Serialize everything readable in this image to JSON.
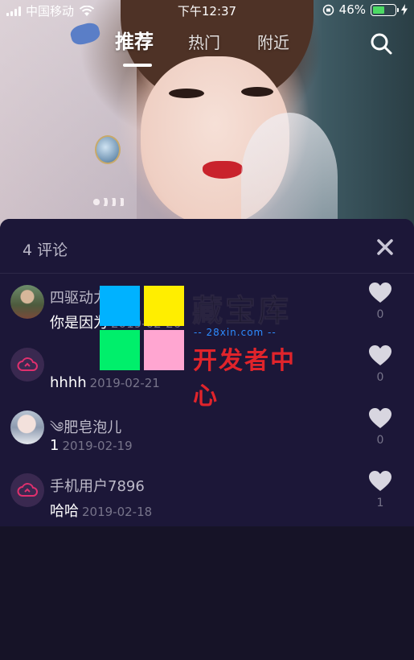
{
  "status_bar": {
    "carrier": "中国移动",
    "time": "下午12:37",
    "battery_percent": "46%",
    "battery_level": 0.46,
    "battery_color": "#4cd964"
  },
  "top_nav": {
    "tabs": [
      {
        "label": "推荐",
        "active": true
      },
      {
        "label": "热门",
        "active": false
      },
      {
        "label": "附近",
        "active": false
      }
    ],
    "search_icon": "search-icon"
  },
  "comments_panel": {
    "title": "4 评论",
    "close_icon": "close-icon",
    "items": [
      {
        "username": "四驱动力",
        "text": "你是因为",
        "date": "2019-02-26",
        "likes": "0",
        "avatar": "user-photo"
      },
      {
        "username": "",
        "text": "hhhh",
        "date": "2019-02-21",
        "likes": "0",
        "avatar": "default-cloud-avatar"
      },
      {
        "username": "༄肥皂泡儿",
        "text": "1",
        "date": "2019-02-19",
        "likes": "0",
        "avatar": "user-photo"
      },
      {
        "username": "手机用户7896",
        "text": "哈哈",
        "date": "2019-02-18",
        "likes": "1",
        "avatar": "default-cloud-avatar"
      }
    ]
  },
  "watermark": {
    "title": "藏宝库",
    "url": "-- 28xin.com --",
    "subtitle": "开发者中心",
    "colors": [
      "#00b2ff",
      "#ffee00",
      "#00ef6b",
      "#ffa6d1"
    ]
  },
  "colors": {
    "panel_bg": "#1c1738",
    "page_bg": "#161327",
    "default_avatar_accent": "#e0306e"
  }
}
